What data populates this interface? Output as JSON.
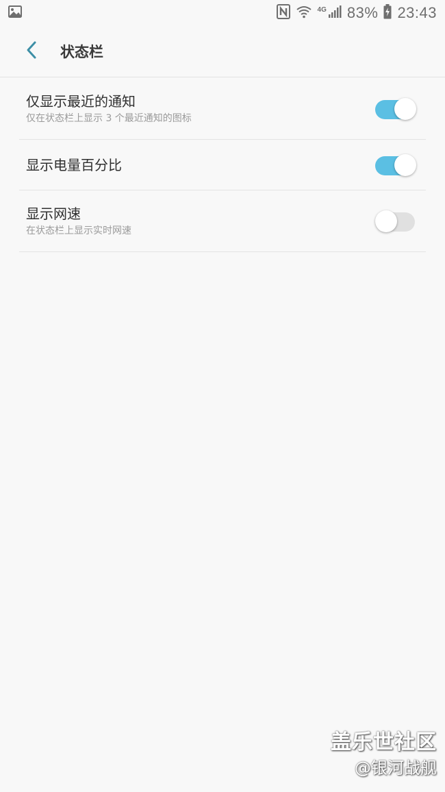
{
  "status_bar": {
    "battery": "83%",
    "time": "23:43",
    "network_type": "4G",
    "icons": [
      "gallery-icon",
      "nfc-icon",
      "wifi-icon",
      "signal-icon",
      "battery-charging-icon"
    ]
  },
  "header": {
    "back_icon": "chevron-left-icon",
    "title": "状态栏"
  },
  "settings": [
    {
      "title": "仅显示最近的通知",
      "subtitle": "仅在状态栏上显示 3 个最近通知的图标",
      "enabled": true
    },
    {
      "title": "显示电量百分比",
      "subtitle": "",
      "enabled": true
    },
    {
      "title": "显示网速",
      "subtitle": "在状态栏上显示实时网速",
      "enabled": false
    }
  ],
  "watermark": {
    "line1": "盖乐世社区",
    "line2": "@银河战舰"
  },
  "colors": {
    "accent": "#5bbfe3",
    "toggle_off": "#e0e0e0",
    "back_arrow": "#3d8fa6",
    "background": "#f8f8f8"
  }
}
